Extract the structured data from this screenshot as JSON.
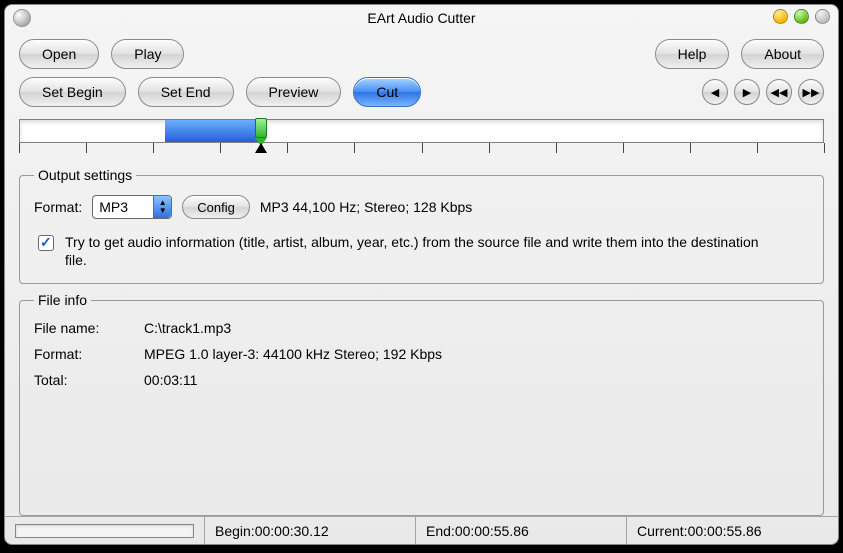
{
  "window": {
    "title": "EArt Audio Cutter"
  },
  "toolbar": {
    "open": "Open",
    "play": "Play",
    "help": "Help",
    "about": "About",
    "set_begin": "Set Begin",
    "set_end": "Set End",
    "preview": "Preview",
    "cut": "Cut"
  },
  "nav_icons": {
    "prev": "◀",
    "next": "▶",
    "rew": "◀◀",
    "ffwd": "▶▶"
  },
  "timeline": {
    "selection_start_pct": 18,
    "selection_end_pct": 30,
    "cursor_pct": 30,
    "tick_count": 12
  },
  "output": {
    "legend": "Output settings",
    "format_label": "Format:",
    "format_value": "MP3",
    "config_btn": "Config",
    "format_desc": "MP3 44,100 Hz; Stereo;  128 Kbps",
    "copy_tags_checked": true,
    "copy_tags_text": "Try to get audio information (title, artist, album, year, etc.) from the source file and write them into the destination file."
  },
  "fileinfo": {
    "legend": "File info",
    "filename_label": "File name:",
    "filename_value": "C:\\track1.mp3",
    "format_label": "Format:",
    "format_value": "MPEG 1.0 layer-3: 44100 kHz Stereo;  192 Kbps",
    "total_label": "Total:",
    "total_value": "00:03:11"
  },
  "status": {
    "begin_label": "Begin: ",
    "begin_value": "00:00:30.12",
    "end_label": "End: ",
    "end_value": "00:00:55.86",
    "current_label": "Current: ",
    "current_value": "00:00:55.86"
  }
}
